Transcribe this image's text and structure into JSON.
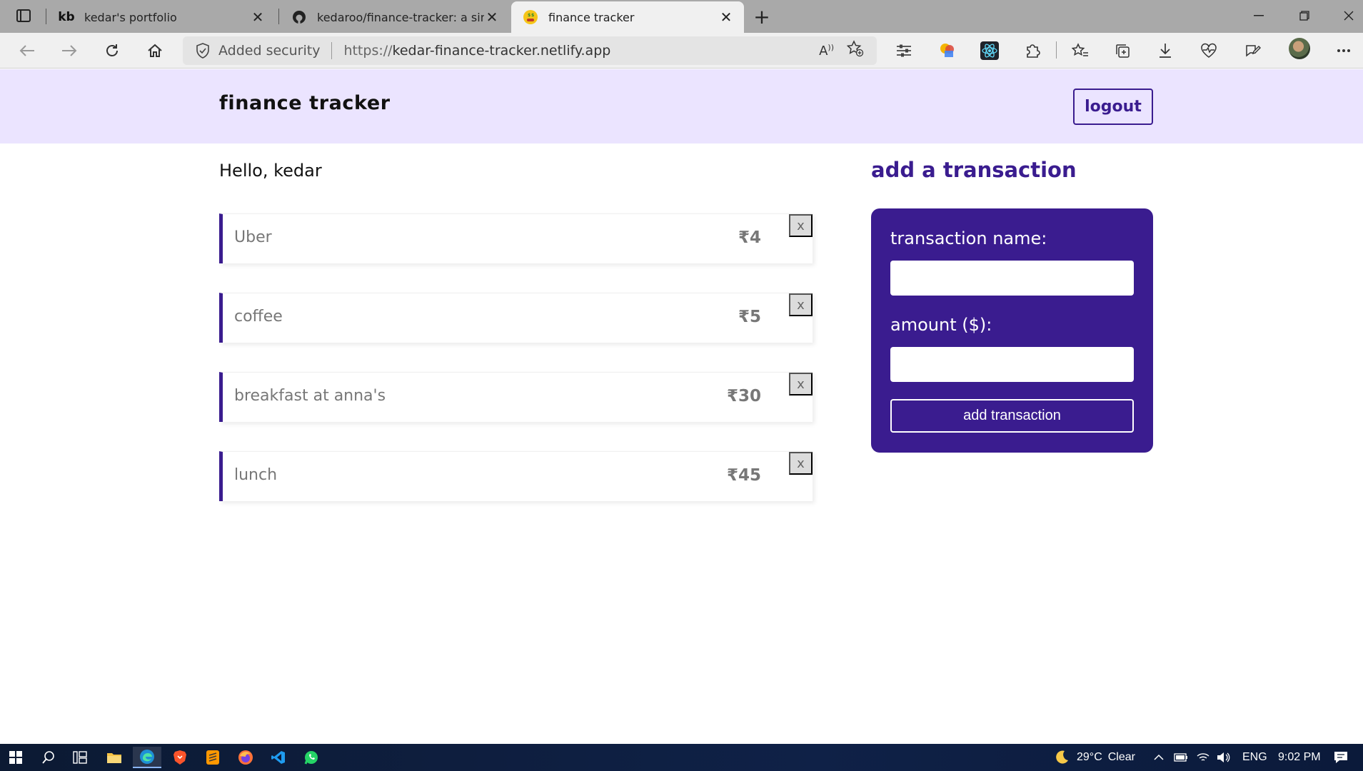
{
  "browser": {
    "tabs": [
      {
        "favicon": "kb",
        "title": "kedar's portfolio"
      },
      {
        "favicon": "github-icon",
        "title": "kedaroo/finance-tracker: a simpl"
      },
      {
        "favicon": "money-face-emoji",
        "title": "finance tracker"
      }
    ],
    "close_glyph": "✕",
    "new_tab_glyph": "+",
    "address": {
      "security_label": "Added security",
      "url_prefix": "https://",
      "url_host": "kedar-finance-tracker.netlify.app"
    }
  },
  "app": {
    "brand": "finance tracker",
    "logout_label": "logout",
    "greeting": "Hello, kedar",
    "transactions": [
      {
        "name": "Uber",
        "amount": "₹4",
        "delete": "x"
      },
      {
        "name": "coffee",
        "amount": "₹5",
        "delete": "x"
      },
      {
        "name": "breakfast at anna's",
        "amount": "₹30",
        "delete": "x"
      },
      {
        "name": "lunch",
        "amount": "₹45",
        "delete": "x"
      }
    ],
    "form": {
      "title": "add a transaction",
      "name_label": "transaction name:",
      "amount_label": "amount ($):",
      "submit_label": "add transaction"
    },
    "colors": {
      "accent": "#3a1c8f",
      "navbar_bg": "#ebe4ff"
    }
  },
  "taskbar": {
    "weather": "29°C",
    "weather_desc": "Clear",
    "language": "ENG",
    "time": "9:02 PM"
  }
}
